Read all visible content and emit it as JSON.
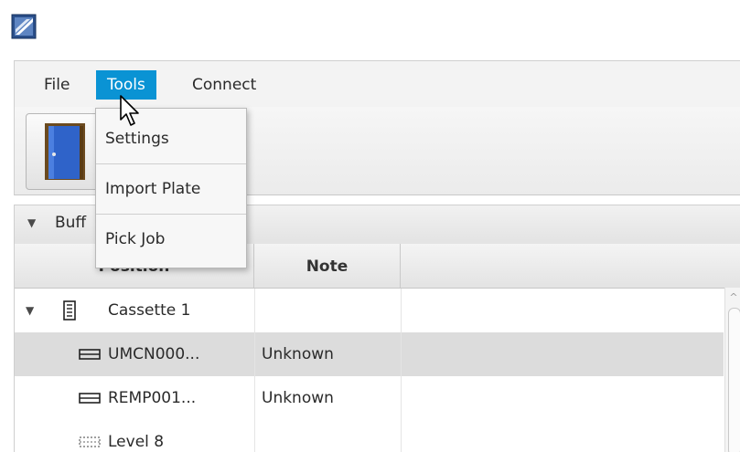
{
  "menubar": {
    "file_label": "File",
    "tools_label": "Tools",
    "connect_label": "Connect"
  },
  "tools_menu": {
    "items": [
      "Settings",
      "Import Plate",
      "Pick Job"
    ]
  },
  "pane": {
    "title": "Buff",
    "expanded": true
  },
  "table": {
    "columns": [
      "Position",
      "Note",
      ""
    ],
    "rows": [
      {
        "position": "Cassette 1",
        "note": "",
        "icon": "cassette-icon",
        "expandable": true,
        "selected": false
      },
      {
        "position": "UMCN000...",
        "note": "Unknown",
        "icon": "plate-icon",
        "expandable": false,
        "selected": true
      },
      {
        "position": "REMP001...",
        "note": "Unknown",
        "icon": "plate-icon",
        "expandable": false,
        "selected": false
      },
      {
        "position": "Level 8",
        "note": "",
        "icon": "empty-level-icon",
        "expandable": false,
        "selected": false
      }
    ]
  },
  "colors": {
    "accent": "#0a93d4",
    "menubar_bg": "#f3f3f3",
    "selected_row": "#dcdcdc",
    "door": "#2f63c9"
  },
  "icons": {
    "app": "app-logo-icon",
    "toolbar_button": "door-icon",
    "pointer": "mouse-pointer-icon"
  }
}
